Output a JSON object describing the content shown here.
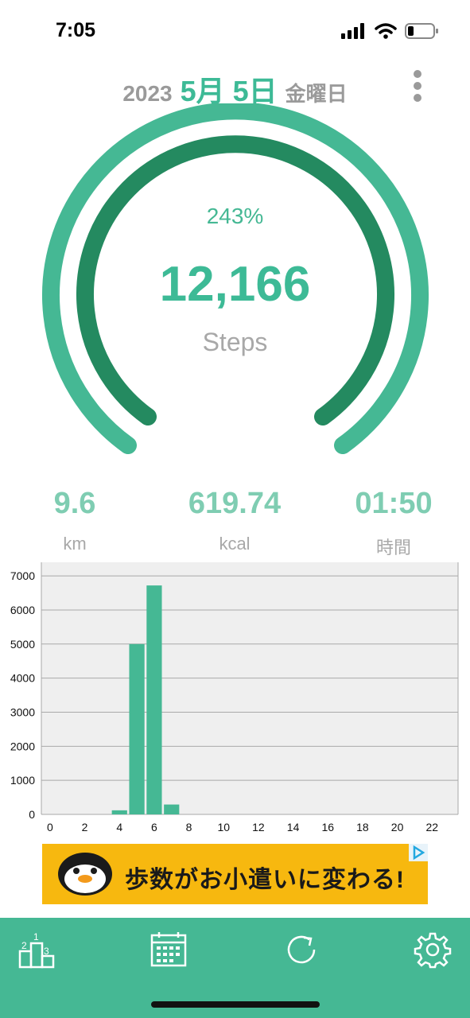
{
  "status_bar": {
    "time": "7:05"
  },
  "header": {
    "year": "2023",
    "month_day": "5月 5日",
    "weekday": "金曜日"
  },
  "gauge": {
    "percent_label": "243%",
    "steps_value": "12,166",
    "steps_label": "Steps",
    "progress_fraction": 2.43
  },
  "stats": [
    {
      "value": "9.6",
      "unit": "km"
    },
    {
      "value": "619.74",
      "unit": "kcal"
    },
    {
      "value": "01:50",
      "unit": "時間"
    }
  ],
  "chart_data": {
    "type": "bar",
    "x_ticks": [
      "0",
      "2",
      "4",
      "6",
      "8",
      "10",
      "12",
      "14",
      "16",
      "18",
      "20",
      "22"
    ],
    "y_ticks": [
      "0",
      "1000",
      "2000",
      "3000",
      "4000",
      "5000",
      "6000",
      "7000"
    ],
    "x": [
      4,
      5,
      6,
      7
    ],
    "values": [
      120,
      5000,
      6720,
      290
    ],
    "xlim": [
      -0.5,
      23.5
    ],
    "ylim": [
      0,
      7400
    ],
    "xlabel": "",
    "ylabel": "",
    "grid": true,
    "bar_color": "#45b894"
  },
  "ad": {
    "text": "歩数がお小遣いに変わる!"
  },
  "tab_bar": {
    "items": [
      {
        "icon": "ranking-icon"
      },
      {
        "icon": "calendar-icon"
      },
      {
        "icon": "refresh-icon"
      },
      {
        "icon": "gear-icon"
      }
    ]
  },
  "colors": {
    "accent": "#45b894",
    "dark_accent": "#248a60",
    "chart_bg": "#efefef"
  }
}
